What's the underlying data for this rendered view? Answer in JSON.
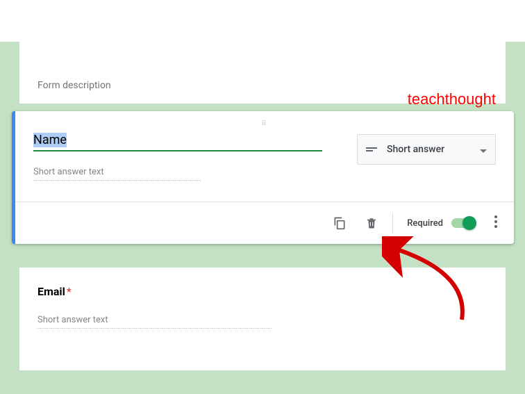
{
  "header": {
    "form_description_placeholder": "Form description"
  },
  "watermark": "teachthought",
  "active_question": {
    "title": "Name",
    "answer_placeholder": "Short answer text",
    "type_selector": {
      "label": "Short answer"
    },
    "footer": {
      "required_label": "Required",
      "required_on": true
    }
  },
  "next_question": {
    "title": "Email",
    "required": true,
    "answer_placeholder": "Short answer text"
  },
  "annotation": {
    "arrow_color": "#d40000"
  }
}
